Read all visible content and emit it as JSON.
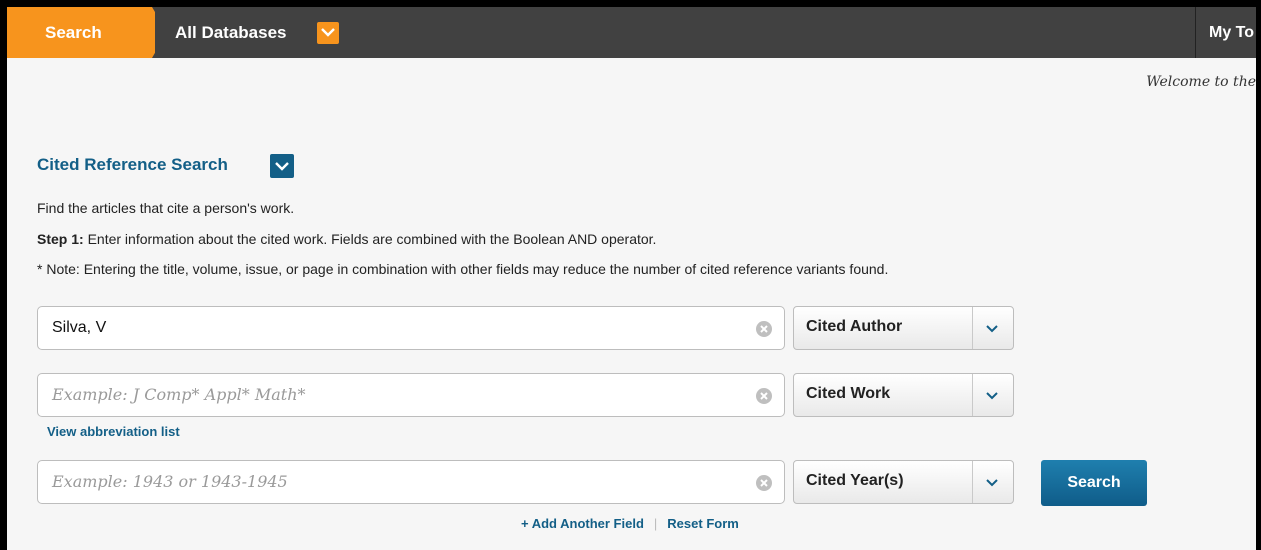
{
  "topbar": {
    "search_tab": "Search",
    "database_label": "All Databases",
    "tools_label": "My To"
  },
  "welcome_text": "Welcome to the",
  "search": {
    "title": "Cited Reference Search",
    "intro": "Find the articles that cite a person's work.",
    "step_label": "Step 1:",
    "step_text": "Enter information about the cited work. Fields are combined with the Boolean AND operator.",
    "note": "* Note: Entering the title, volume, issue, or page in combination with other fields may reduce the number of cited reference variants found."
  },
  "fields": [
    {
      "value": "Silva, V",
      "placeholder": "",
      "field_type": "Cited Author"
    },
    {
      "value": "",
      "placeholder": "Example: J Comp* Appl* Math*",
      "field_type": "Cited Work"
    },
    {
      "value": "",
      "placeholder": "Example: 1943 or 1943-1945",
      "field_type": "Cited Year(s)"
    }
  ],
  "abbreviation_link": "View abbreviation list",
  "search_button": "Search",
  "add_field_link": "+ Add Another Field",
  "reset_link": "Reset Form",
  "colors": {
    "accent_orange": "#f7941d",
    "link_blue": "#135f87",
    "topbar": "#414141"
  }
}
